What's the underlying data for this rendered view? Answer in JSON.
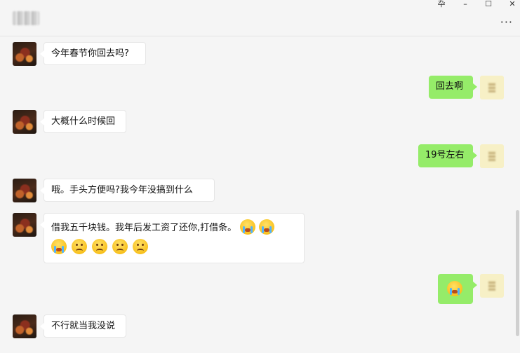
{
  "header": {
    "chat_name": "",
    "window_controls": {
      "pin": "卆",
      "minimize": "–",
      "maximize": "☐",
      "close": "✕"
    },
    "more_label": "···"
  },
  "messages": [
    {
      "side": "left",
      "text": "今年春节你回去吗?"
    },
    {
      "side": "right",
      "text": "回去啊"
    },
    {
      "side": "left",
      "text": "大概什么时候回"
    },
    {
      "side": "right",
      "text": "19号左右"
    },
    {
      "side": "left",
      "text": "哦。手头方便吗?我今年没搞到什么"
    },
    {
      "side": "left",
      "text": "借我五千块钱。我年后发工资了还你,打借条。",
      "emojis": [
        "crying-face",
        "crying-face",
        "crying-face",
        "sad-face",
        "sad-face",
        "sad-face",
        "sad-face"
      ]
    },
    {
      "side": "right",
      "text": "",
      "emojis": [
        "crying-face"
      ]
    },
    {
      "side": "left",
      "text": "不行就当我没说"
    }
  ],
  "colors": {
    "sent_bubble": "#95ec69",
    "received_bubble": "#ffffff",
    "background": "#f5f5f5"
  }
}
